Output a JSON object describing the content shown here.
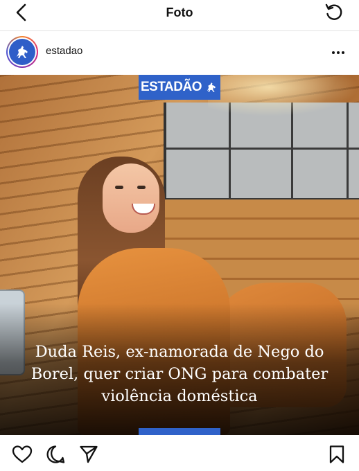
{
  "topbar": {
    "title": "Foto",
    "back_icon": "chevron-left-icon",
    "refresh_icon": "refresh-icon"
  },
  "post": {
    "username": "estadao",
    "avatar_icon": "horse-rider-logo-icon",
    "more_icon": "more-horizontal-icon",
    "media": {
      "brand_logo": "ESTADÃO",
      "headline": "Duda Reis, ex-namorada de Nego do Borel, quer criar ONG para combater violência doméstica"
    }
  },
  "actions": {
    "like_icon": "heart-icon",
    "comment_icon": "comment-icon",
    "share_icon": "send-icon",
    "save_icon": "bookmark-icon"
  },
  "colors": {
    "brand_blue": "#2f62c9",
    "text": "#111111",
    "background": "#ffffff"
  }
}
